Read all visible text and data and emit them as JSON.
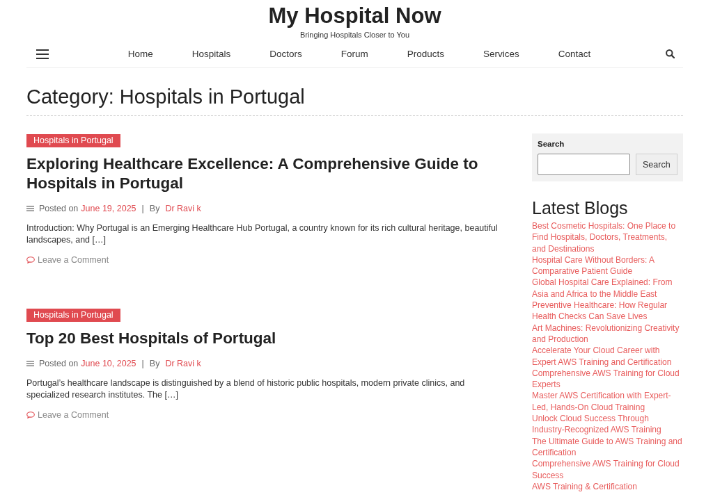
{
  "site": {
    "title": "My Hospital Now",
    "tagline": "Bringing Hospitals Closer to You"
  },
  "nav": {
    "links": [
      "Home",
      "Hospitals",
      "Doctors",
      "Forum",
      "Products",
      "Services",
      "Contact"
    ]
  },
  "page_title": "Category: Hospitals in Portugal",
  "posts": [
    {
      "category": "Hospitals in Portugal",
      "title": "Exploring Healthcare Excellence: A Comprehensive Guide to Hospitals in Portugal",
      "meta": {
        "posted_label": "Posted on",
        "date": "June 19, 2025",
        "separator": "|",
        "by_label": "By",
        "author": "Dr Ravi k"
      },
      "excerpt": "Introduction: Why Portugal is an Emerging Healthcare Hub Portugal, a country known for its rich cultural heritage, beautiful landscapes, and […]",
      "comment_link": "Leave a Comment"
    },
    {
      "category": "Hospitals in Portugal",
      "title": "Top 20 Best Hospitals of Portugal",
      "meta": {
        "posted_label": "Posted on",
        "date": "June 10, 2025",
        "separator": "|",
        "by_label": "By",
        "author": "Dr Ravi k"
      },
      "excerpt": "Portugal’s healthcare landscape is distinguished by a blend of historic public hospitals, modern private clinics, and specialized research institutes. The […]",
      "comment_link": "Leave a Comment"
    }
  ],
  "sidebar": {
    "search": {
      "label": "Search",
      "button": "Search"
    },
    "latest_blogs": {
      "heading": "Latest Blogs",
      "items": [
        "Best Cosmetic Hospitals: One Place to Find Hospitals, Doctors, Treatments, and Destinations",
        "Hospital Care Without Borders: A Comparative Patient Guide",
        "Global Hospital Care Explained: From Asia and Africa to the Middle East",
        "Preventive Healthcare: How Regular Health Checks Can Save Lives",
        "Art Machines: Revolutionizing Creativity and Production",
        "Accelerate Your Cloud Career with Expert AWS Training and Certification",
        "Comprehensive AWS Training for Cloud Experts",
        "Master AWS Certification with Expert-Led, Hands-On Cloud Training",
        "Unlock Cloud Success Through Industry-Recognized AWS Training",
        "The Ultimate Guide to AWS Training and Certification",
        "Comprehensive AWS Training for Cloud Success",
        "AWS Training & Certification"
      ]
    }
  }
}
